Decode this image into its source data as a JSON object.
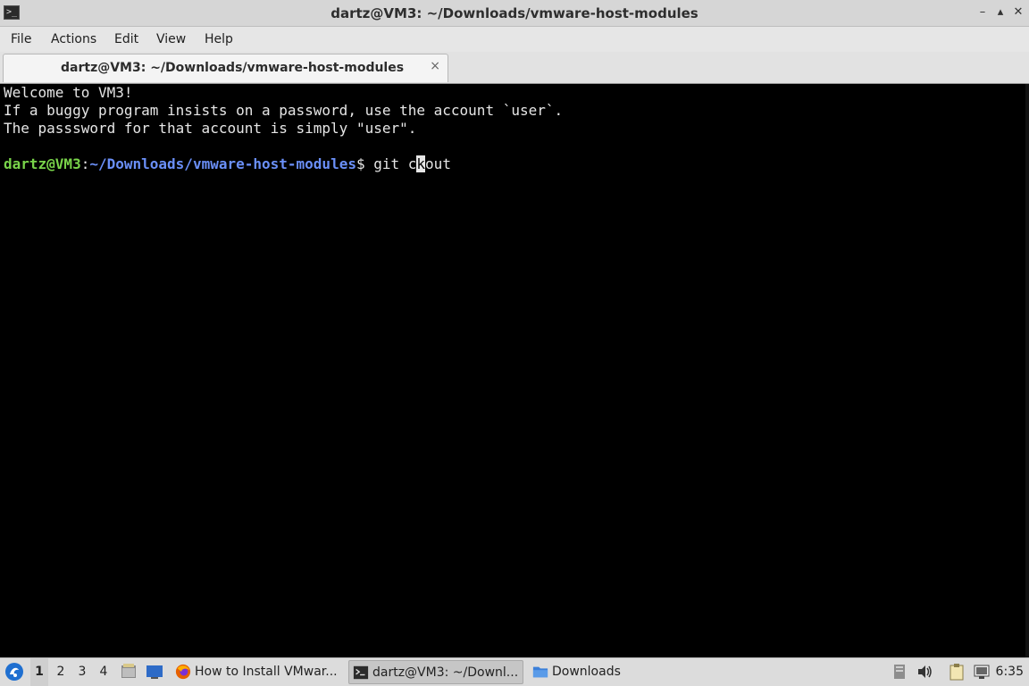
{
  "window": {
    "title": "dartz@VM3: ~/Downloads/vmware-host-modules",
    "icon": "terminal-icon",
    "controls": [
      "minimize-icon",
      "maximize-icon",
      "close-icon"
    ]
  },
  "menu": {
    "items": [
      {
        "label": "File"
      },
      {
        "label": "Actions"
      },
      {
        "label": "Edit"
      },
      {
        "label": "View"
      },
      {
        "label": "Help"
      }
    ]
  },
  "tab": {
    "label": "dartz@VM3: ~/Downloads/vmware-host-modules",
    "close": "×"
  },
  "terminal": {
    "lines": [
      "Welcome to VM3!",
      "If a buggy program insists on a password, use the account `user`.",
      "The passsword for that account is simply \"user\"."
    ],
    "prompt": {
      "user": "dartz@VM3",
      "sep": ":",
      "path": "~/Downloads/vmware-host-modules",
      "dollar": "$",
      "command_before_cursor": " git c",
      "cursor_char": "k",
      "command_after_cursor": "out"
    },
    "colors": {
      "user": "#79d44a",
      "path": "#6a8ff7",
      "text": "#e6e6e6",
      "background": "#000000"
    }
  },
  "taskbar": {
    "start_icon": "lxqt-start-icon",
    "workspaces": [
      "1",
      "2",
      "3",
      "4"
    ],
    "active_workspace": "1",
    "quicklaunch": [
      "file-manager-icon",
      "desktop-icon"
    ],
    "tasks": [
      {
        "label": "How to Install VMwar...",
        "icon": "firefox-icon",
        "active": false
      },
      {
        "label": "dartz@VM3: ~/Downl...",
        "icon": "terminal-icon",
        "active": true
      },
      {
        "label": "Downloads",
        "icon": "folder-icon",
        "active": false
      }
    ],
    "tray": [
      "removable-drive-icon",
      "volume-icon",
      "clipboard-icon",
      "network-icon"
    ],
    "clock": "6:35"
  }
}
